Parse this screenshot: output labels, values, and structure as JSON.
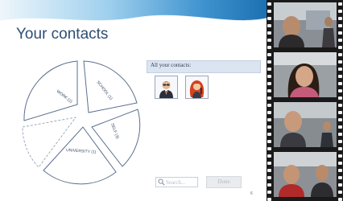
{
  "page": {
    "title": "Your contacts",
    "page_number": "6"
  },
  "wheel": {
    "segments": [
      {
        "label": "WORK (2)"
      },
      {
        "label": "SCHOOL (1)"
      },
      {
        "label": "SELF (3)"
      },
      {
        "label": "UNIVERSITY (1)"
      },
      {
        "label": ""
      }
    ]
  },
  "contacts": {
    "header": "All your contacts:",
    "avatars": [
      {
        "icon": "man-in-suit-avatar-icon"
      },
      {
        "icon": "red-haired-woman-avatar-icon"
      }
    ]
  },
  "search": {
    "placeholder": "Search..."
  },
  "done": {
    "label": "Done"
  },
  "colors": {
    "accent": "#2e4e73",
    "header_wave": "#4a9bd1",
    "panel_bg": "#dbe4f1",
    "wheel_stroke": "#5a6f8f"
  }
}
